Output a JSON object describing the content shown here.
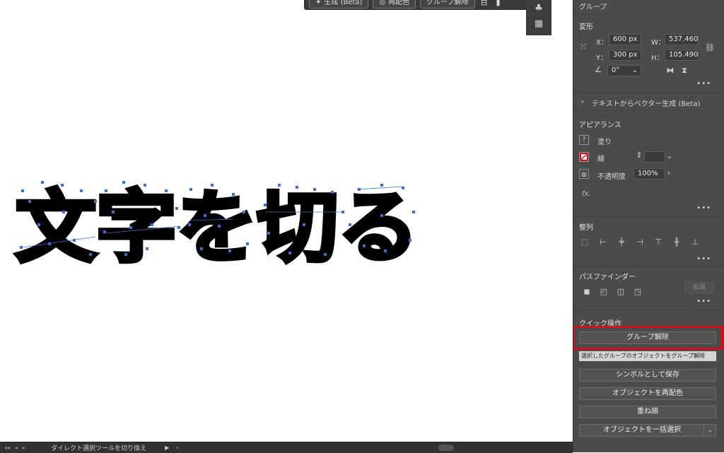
{
  "taskbar": {
    "generate_label": "生成 (Beta)",
    "recolor_label": "再配色",
    "ungroup_label": "グループ解除"
  },
  "artwork": {
    "text": "文字を切る",
    "fill_color": "#000000",
    "anchor_color": "#3c6fd8"
  },
  "panel": {
    "title": "グループ",
    "transform": {
      "title": "変形",
      "x_label": "X：",
      "x_value": "600 px",
      "y_label": "Y：",
      "y_value": "300 px",
      "w_label": "W：",
      "w_value": "537.460",
      "h_label": "H：",
      "h_value": "105.490",
      "angle_value": "0°"
    },
    "text_to_vector": {
      "label": "テキストからベクター生成 (Beta)"
    },
    "appearance": {
      "title": "アピアランス",
      "fill_label": "塗り",
      "stroke_label": "線",
      "opacity_label": "不透明度",
      "opacity_value": "100%",
      "fx_label": "fx."
    },
    "align": {
      "title": "整列"
    },
    "pathfinder": {
      "title": "パスファインダー",
      "expand_label": "拡張"
    },
    "quick_actions": {
      "title": "クイック操作",
      "ungroup_label": "グループ解除",
      "tooltip": "選択したグループのオブジェクトをグループ解除",
      "save_symbol_label": "シンボルとして保存",
      "recolor_label": "オブジェクトを再配色",
      "arrange_label": "重ね順",
      "select_same_label": "オブジェクトを一括選択"
    },
    "more_glyph": "•••",
    "highlight_color": "#d0101a"
  },
  "statusbar": {
    "text": "ダイレクト選択ツールを切り換え"
  }
}
